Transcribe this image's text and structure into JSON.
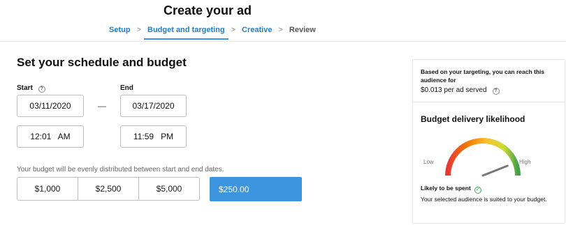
{
  "header": {
    "title": "Create your ad",
    "steps": [
      {
        "label": "Setup"
      },
      {
        "label": "Budget and targeting"
      },
      {
        "label": "Creative"
      },
      {
        "label": "Review"
      }
    ],
    "separator": ">"
  },
  "schedule": {
    "title": "Set your schedule and budget",
    "start_label": "Start",
    "end_label": "End",
    "start_date": "03/11/2020",
    "end_date": "03/17/2020",
    "start_time": "12:01   AM",
    "end_time": "11:59   PM",
    "dash": "—"
  },
  "budget": {
    "note": "Your budget will be evenly distributed between start and end dates.",
    "options": [
      "$1,000",
      "$2,500",
      "$5,000"
    ],
    "custom_value": "$250.00"
  },
  "panel": {
    "reach_text": "Based on your targeting, you can reach this audience for",
    "cost_text": "$0.013 per ad served",
    "likelihood_title": "Budget delivery likelihood",
    "low_label": "Low",
    "high_label": "High",
    "likelihood_level": 0.88,
    "spent_label": "Likely to be spent",
    "description": "Your selected audience is suited to your budget."
  },
  "colors": {
    "accent": "#3d95e0",
    "link": "#1f7ec4",
    "success": "#3ca54a"
  },
  "icons": [
    "help-icon",
    "chevron-right-icon",
    "check-circle-icon"
  ]
}
